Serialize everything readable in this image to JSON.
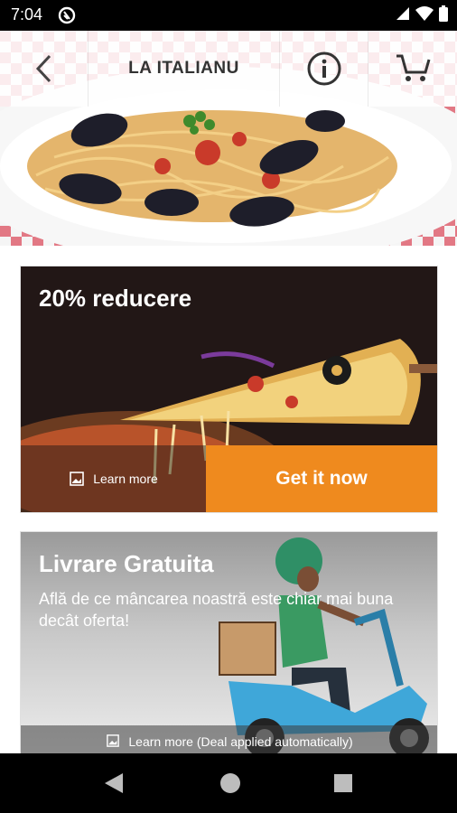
{
  "status_bar": {
    "time": "7:04"
  },
  "header": {
    "title": "LA ITALIANU"
  },
  "offers": [
    {
      "title": "20% reducere",
      "learn_more": "Learn more",
      "cta": "Get it now"
    },
    {
      "title": "Livrare Gratuita",
      "description": "Află de ce mâncarea noastră este chiar mai buna decât oferta!",
      "learn_more": "Learn more (Deal applied automatically)"
    }
  ],
  "colors": {
    "accent": "#ef8a1e",
    "status_bar": "#000000"
  }
}
